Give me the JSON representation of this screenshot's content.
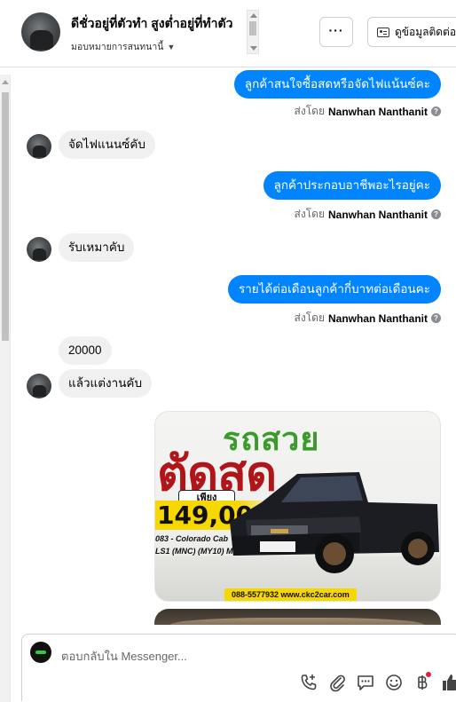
{
  "header": {
    "contact_name": "ดีชั่วอยู่ที่ตัวทำ สูงต่ำอยู่ที่ทำตัว",
    "assign_label": "มอบหมายการสนทนานี้",
    "more_label": "···",
    "info_button_label": "ดูข้อมูลติดต่อ"
  },
  "messages": {
    "out1": "ลูกค้าสนใจซื้อสดหรือจัดไฟแน้นซ์คะ",
    "in1": "จัดไฟแนนซ์คับ",
    "out2": "ลูกค้าประกอบอาชีพอะไรอยู่คะ",
    "in2": "รับเหมาคับ",
    "out3": "รายได้ต่อเดือนลูกค้ากี่บาทต่อเดือนคะ",
    "in3": "20000",
    "in4": "แล้วแต่งานคับ",
    "sent_by_prefix": "ส่งโดย",
    "sender_name": "Nanwhan Nanthanit",
    "help_glyph": "?"
  },
  "ad_image": {
    "headline_green": "รถสวย",
    "headline_red": "ตัดสด",
    "price_prefix": "เพียง",
    "price": "149,000",
    "model_line1": "083 - Colorado Cab",
    "model_line2": "LS1 (MNC) (MY10) M",
    "contact": "088-5577932 www.ckc2car.com"
  },
  "composer": {
    "placeholder": "ตอบกลับใน Messenger..."
  },
  "icons": [
    "ellipsis-icon",
    "contact-card-icon",
    "phone-add-icon",
    "attachment-icon",
    "saved-reply-icon",
    "emoji-icon",
    "baht-icon",
    "like-icon"
  ],
  "colors": {
    "outgoing_bubble": "#0084ff",
    "incoming_bubble": "#f0f0f0",
    "text_secondary": "#65676b"
  }
}
